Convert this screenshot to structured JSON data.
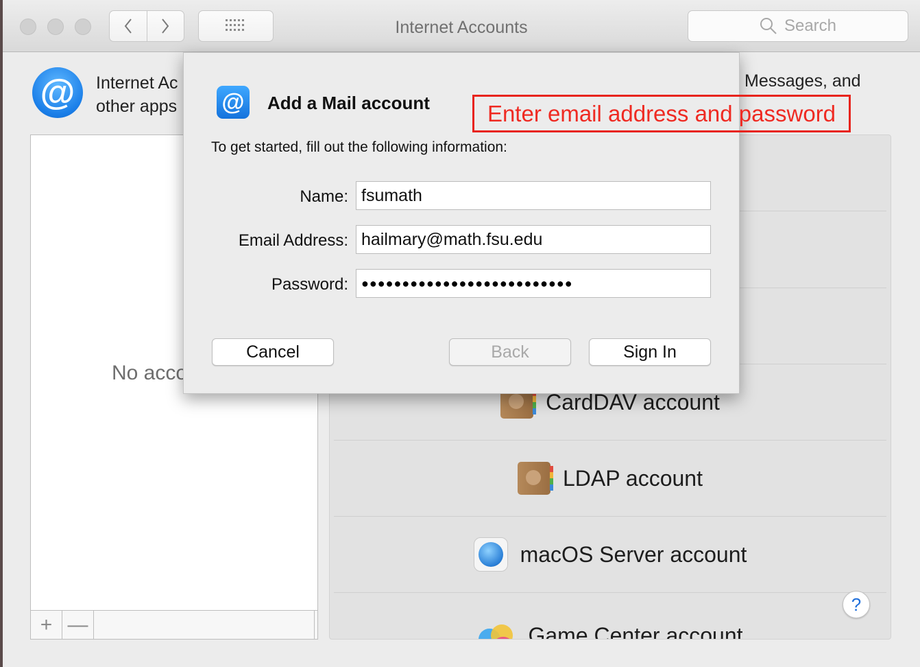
{
  "window": {
    "title": "Internet Accounts",
    "search_placeholder": "Search"
  },
  "header": {
    "text_line1": "Internet Ac",
    "text_line2": "other apps",
    "text_right": "Messages, and"
  },
  "accounts": {
    "empty_text": "No acco",
    "add_label": "+",
    "remove_label": "—"
  },
  "providers": [
    {
      "label": "CardDAV account",
      "icon": "address-book-icon"
    },
    {
      "label": "LDAP account",
      "icon": "address-book-icon"
    },
    {
      "label": "macOS Server account",
      "icon": "globe-icon"
    },
    {
      "label": "Game Center account",
      "icon": "game-center-icon"
    }
  ],
  "help_label": "?",
  "sheet": {
    "title": "Add a Mail account",
    "intro": "To get started, fill out the following information:",
    "name_label": "Name:",
    "name_value": "fsumath",
    "email_label": "Email Address:",
    "email_value": "hailmary@math.fsu.edu",
    "password_label": "Password:",
    "password_masked": "●●●●●●●●●●●●●●●●●●●●●●●●●●",
    "cancel_label": "Cancel",
    "back_label": "Back",
    "signin_label": "Sign In"
  },
  "annotation": {
    "text": "Enter email address and password",
    "color": "#e8241d"
  }
}
